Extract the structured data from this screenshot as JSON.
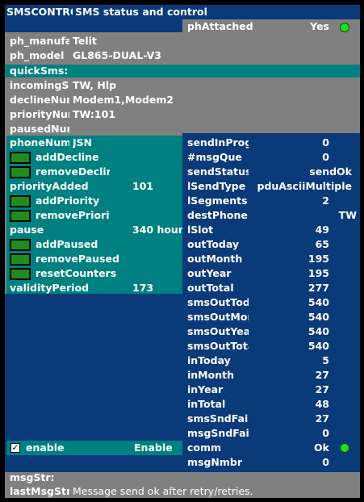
{
  "window": {
    "id": "SMSCONTROL",
    "title": "SMS status and control"
  },
  "left_info": [
    {
      "label": "ph_manufacturer",
      "value": "Telit"
    },
    {
      "label": "ph_model",
      "value": "GL865-DUAL-V3"
    },
    {
      "label": "quickSms:",
      "value": ""
    },
    {
      "label": "incomingSms",
      "value": "TW, Hlp"
    },
    {
      "label": "declineNumbers",
      "value": "Modem1,Modem2"
    },
    {
      "label": "priorityNumbers",
      "value": "TW:101"
    },
    {
      "label": "pausedNumbers",
      "value": ""
    }
  ],
  "phone_num": {
    "label": "phoneNumber",
    "value": "JSN"
  },
  "actions": {
    "add_decline": "addDecline",
    "remove_decline": "removeDecline",
    "priority_added": {
      "label": "priorityAdded",
      "value": "101"
    },
    "add_priority": "addPriority",
    "remove_priority": "removePriority",
    "pause": {
      "label": "pause",
      "value": "340 hour"
    },
    "add_paused": "addPaused",
    "remove_paused": "removePaused",
    "reset_counters": "resetCounters",
    "validity": {
      "label": "validityPeriod",
      "value": "173"
    }
  },
  "enable": {
    "label": "enable",
    "value": "Enable",
    "checked": true
  },
  "ph_attached": {
    "label": "phAttached",
    "value": "Yes",
    "status": "green"
  },
  "status": [
    {
      "label": "sendInProgress",
      "value": "0"
    },
    {
      "label": "#msgQue",
      "value": "0"
    },
    {
      "label": "sendStatus",
      "value": "sendOk"
    },
    {
      "label": "lSendType",
      "value": "pduAsciiMultiple"
    },
    {
      "label": "lSegments",
      "value": "2"
    },
    {
      "label": "destPhone",
      "value": "TW"
    },
    {
      "label": "lSlot",
      "value": "49"
    },
    {
      "label": "outToday",
      "value": "65"
    },
    {
      "label": "outMonth",
      "value": "195"
    },
    {
      "label": "outYear",
      "value": "195"
    },
    {
      "label": "outTotal",
      "value": "277"
    },
    {
      "label": "smsOutToday",
      "value": "540"
    },
    {
      "label": "smsOutMonth",
      "value": "540"
    },
    {
      "label": "smsOutYear",
      "value": "540"
    },
    {
      "label": "smsOutTotal",
      "value": "540"
    },
    {
      "label": "inToday",
      "value": "5"
    },
    {
      "label": "inMonth",
      "value": "27"
    },
    {
      "label": "inYear",
      "value": "27"
    },
    {
      "label": "inTotal",
      "value": "48"
    },
    {
      "label": "smsSndFailCnt",
      "value": "27"
    },
    {
      "label": "msgSndFailCnt",
      "value": "0"
    },
    {
      "label": "comm",
      "value": "Ok",
      "status": "green"
    },
    {
      "label": "msgNmbr",
      "value": "0"
    }
  ],
  "bottom": [
    {
      "label": "msgStr:",
      "value": ""
    },
    {
      "label": "lastMsgStr",
      "value": "Message send ok after retry/retries."
    }
  ],
  "colors": {
    "navy": "#0a3a7a",
    "teal": "#008080",
    "grey": "#808080",
    "led": "#22dd22",
    "checkbox": "#1e8c1e"
  }
}
